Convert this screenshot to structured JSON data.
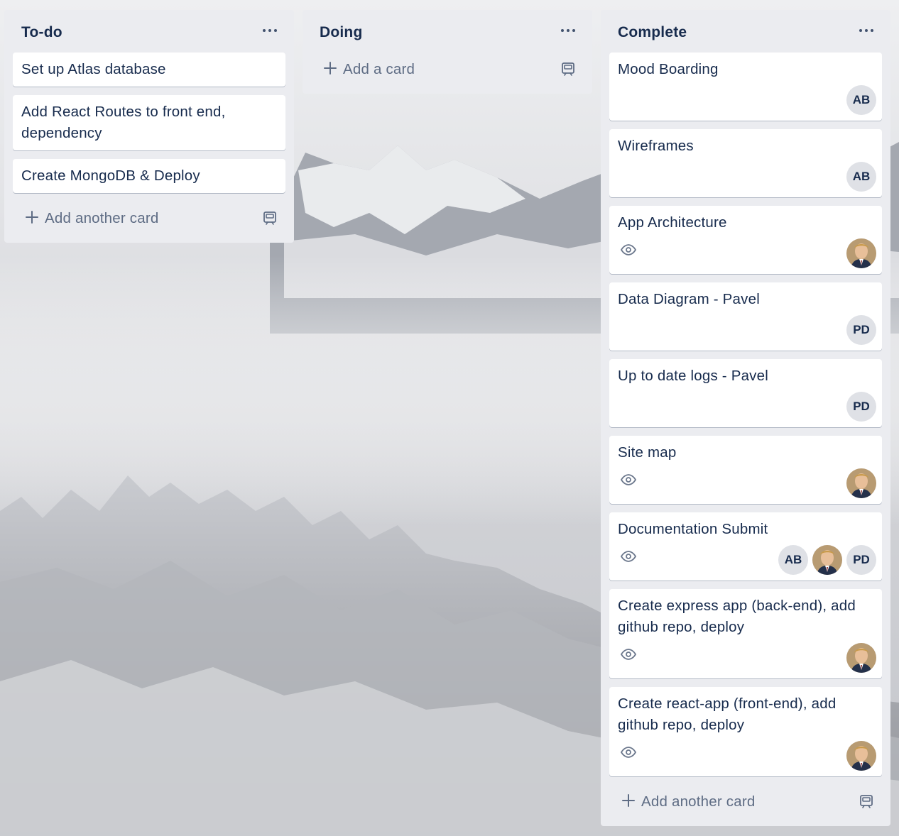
{
  "lists": [
    {
      "title": "To-do",
      "menu_icon": "ellipsis-icon",
      "cards": [
        {
          "title": "Set up Atlas database"
        },
        {
          "title": "Add React Routes to front end, dependency"
        },
        {
          "title": "Create MongoDB & Deploy"
        }
      ],
      "add_label": "Add another card"
    },
    {
      "title": "Doing",
      "menu_icon": "ellipsis-icon",
      "cards": [],
      "add_label": "Add a card"
    },
    {
      "title": "Complete",
      "menu_icon": "ellipsis-icon",
      "cards": [
        {
          "title": "Mood Boarding",
          "watching": false,
          "members": [
            "AB"
          ]
        },
        {
          "title": "Wireframes",
          "watching": false,
          "members": [
            "AB"
          ]
        },
        {
          "title": "App Architecture",
          "watching": true,
          "members": [
            "photo"
          ]
        },
        {
          "title": "Data Diagram - Pavel",
          "watching": false,
          "members": [
            "PD"
          ]
        },
        {
          "title": "Up to date logs - Pavel",
          "watching": false,
          "members": [
            "PD"
          ]
        },
        {
          "title": "Site map",
          "watching": true,
          "members": [
            "photo"
          ]
        },
        {
          "title": "Documentation Submit",
          "watching": true,
          "members": [
            "AB",
            "photo",
            "PD"
          ]
        },
        {
          "title": "Create express app (back-end), add github repo, deploy",
          "watching": true,
          "members": [
            "photo"
          ]
        },
        {
          "title": "Create react-app (front-end), add github repo, deploy",
          "watching": true,
          "members": [
            "photo"
          ]
        }
      ],
      "add_label": "Add another card"
    }
  ],
  "colors": {
    "list_bg": "#ebecf0",
    "card_bg": "#ffffff",
    "text": "#172b4d",
    "muted_text": "#5e6c84",
    "avatar_bg": "#dfe1e6"
  }
}
